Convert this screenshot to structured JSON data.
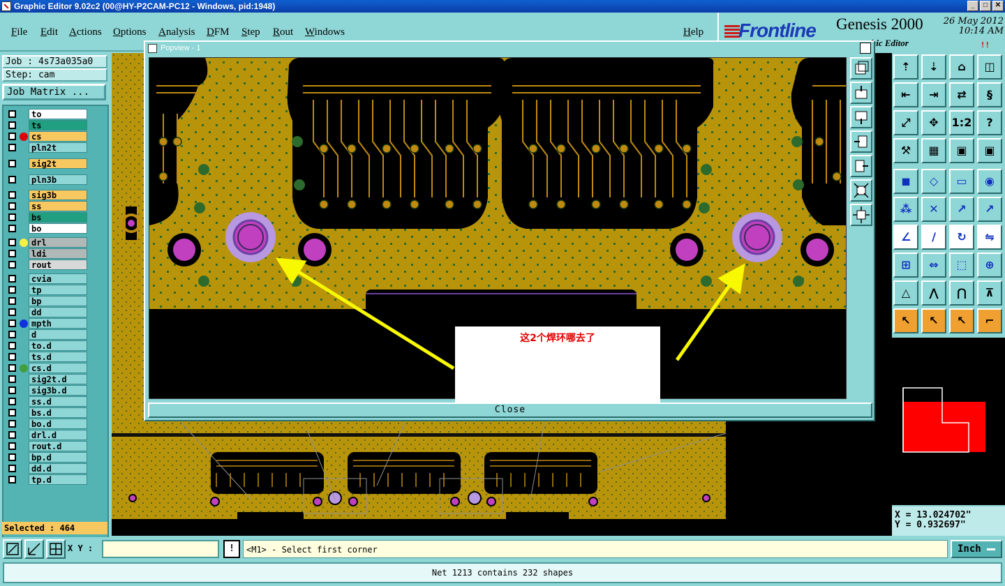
{
  "window": {
    "title": "Graphic Editor 9.02c2 (00@HY-P2CAM-PC12 - Windows, pid:1948)"
  },
  "menu": {
    "items": [
      "File",
      "Edit",
      "Actions",
      "Options",
      "Analysis",
      "DFM",
      "Step",
      "Rout",
      "Windows"
    ],
    "help": "Help"
  },
  "brand": {
    "logo": "Frontline",
    "product": "Genesis 2000",
    "subtitle": "hic Editor",
    "date": "26 May 2012",
    "time": "10:14 AM",
    "indicator": "!!"
  },
  "left": {
    "job": "Job : 4s73a035a0",
    "step": "Step: cam",
    "job_matrix": "Job Matrix ...",
    "layers": [
      {
        "name": "to",
        "color": "#ffffff"
      },
      {
        "name": "ts",
        "color": "#20a080"
      },
      {
        "name": "cs",
        "color": "#f8c860",
        "dot": "#e00000"
      },
      {
        "name": "pln2t",
        "color": "#8fd6d6"
      },
      {
        "name": "sig2t",
        "color": "#f8c860"
      },
      {
        "name": "pln3b",
        "color": "#8fd6d6"
      },
      {
        "name": "sig3b",
        "color": "#f8c860"
      },
      {
        "name": "ss",
        "color": "#f8c860"
      },
      {
        "name": "bs",
        "color": "#20a080"
      },
      {
        "name": "bo",
        "color": "#ffffff"
      },
      {
        "name": "drl",
        "color": "#b0b8b8",
        "dot": "#f8f040"
      },
      {
        "name": "ldi",
        "color": "#b0b8b8"
      },
      {
        "name": "rout",
        "color": "#d8d8d8"
      },
      {
        "name": "cvia",
        "color": "#8fd6d6"
      },
      {
        "name": "tp",
        "color": "#8fd6d6"
      },
      {
        "name": "bp",
        "color": "#8fd6d6"
      },
      {
        "name": "dd",
        "color": "#8fd6d6"
      },
      {
        "name": "mpth",
        "color": "#8fd6d6",
        "dot": "#1030e0"
      },
      {
        "name": "d",
        "color": "#8fd6d6"
      },
      {
        "name": "to.d",
        "color": "#8fd6d6"
      },
      {
        "name": "ts.d",
        "color": "#8fd6d6"
      },
      {
        "name": "cs.d",
        "color": "#8fd6d6",
        "dot": "#40a040"
      },
      {
        "name": "sig2t.d",
        "color": "#8fd6d6"
      },
      {
        "name": "sig3b.d",
        "color": "#8fd6d6"
      },
      {
        "name": "ss.d",
        "color": "#8fd6d6"
      },
      {
        "name": "bs.d",
        "color": "#8fd6d6"
      },
      {
        "name": "bo.d",
        "color": "#8fd6d6"
      },
      {
        "name": "drl.d",
        "color": "#8fd6d6"
      },
      {
        "name": "rout.d",
        "color": "#8fd6d6"
      },
      {
        "name": "bp.d",
        "color": "#8fd6d6"
      },
      {
        "name": "dd.d",
        "color": "#8fd6d6"
      },
      {
        "name": "tp.d",
        "color": "#8fd6d6"
      }
    ],
    "selected": "Selected : 464"
  },
  "popview": {
    "title": "Popview - 1",
    "close_x": "✕",
    "close_label": "Close"
  },
  "annotation": {
    "text": "这2个焊环哪去了"
  },
  "coords": {
    "x": "X = 13.024702\"",
    "y": "Y = 0.932697\""
  },
  "cmd": {
    "xy_label": "X Y :",
    "xy_value": "",
    "exclaim": "!",
    "prompt": "<M1> - Select first corner",
    "units": "Inch"
  },
  "status": {
    "text": "Net 1213 contains 232 shapes"
  },
  "colors": {
    "board": "#b8940a",
    "copper": "#c08a10",
    "pad_magenta": "#c040c0",
    "annulus": "#b898e0",
    "annotation_arrow": "#f8f800"
  }
}
